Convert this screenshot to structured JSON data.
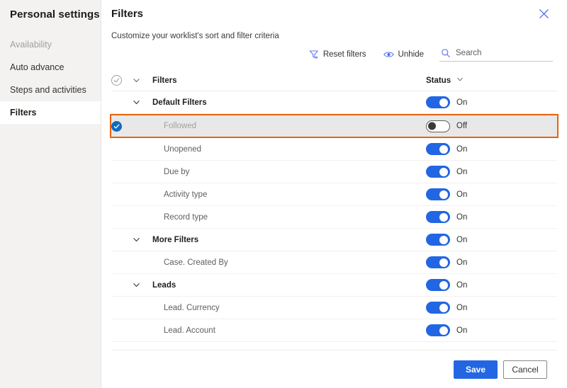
{
  "sidebar": {
    "title": "Personal settings",
    "items": [
      {
        "label": "Availability",
        "state": "disabled"
      },
      {
        "label": "Auto advance",
        "state": "normal"
      },
      {
        "label": "Steps and activities",
        "state": "normal"
      },
      {
        "label": "Filters",
        "state": "selected"
      }
    ]
  },
  "panel": {
    "title": "Filters",
    "subtitle": "Customize your worklist's sort and filter criteria",
    "close_label": "Close"
  },
  "toolbar": {
    "reset_filters_label": "Reset filters",
    "unhide_label": "Unhide",
    "search_placeholder": "Search",
    "search_value": ""
  },
  "table": {
    "header": {
      "name": "Filters",
      "status": "Status"
    },
    "rows": [
      {
        "label": "Default Filters",
        "type": "group",
        "indent": 0,
        "toggle": "on",
        "toggle_label": "On",
        "selected": false
      },
      {
        "label": "Followed",
        "type": "item",
        "indent": 1,
        "toggle": "off",
        "toggle_label": "Off",
        "selected": true
      },
      {
        "label": "Unopened",
        "type": "item",
        "indent": 1,
        "toggle": "on",
        "toggle_label": "On",
        "selected": false
      },
      {
        "label": "Due by",
        "type": "item",
        "indent": 1,
        "toggle": "on",
        "toggle_label": "On",
        "selected": false
      },
      {
        "label": "Activity type",
        "type": "item",
        "indent": 1,
        "toggle": "on",
        "toggle_label": "On",
        "selected": false
      },
      {
        "label": "Record type",
        "type": "item",
        "indent": 1,
        "toggle": "on",
        "toggle_label": "On",
        "selected": false
      },
      {
        "label": "More Filters",
        "type": "group",
        "indent": 0,
        "toggle": "on",
        "toggle_label": "On",
        "selected": false
      },
      {
        "label": "Case. Created By",
        "type": "item",
        "indent": 1,
        "toggle": "on",
        "toggle_label": "On",
        "selected": false
      },
      {
        "label": "Leads",
        "type": "group",
        "indent": 0,
        "toggle": "on",
        "toggle_label": "On",
        "selected": false
      },
      {
        "label": "Lead. Currency",
        "type": "item",
        "indent": 1,
        "toggle": "on",
        "toggle_label": "On",
        "selected": false
      },
      {
        "label": "Lead. Account",
        "type": "item",
        "indent": 1,
        "toggle": "on",
        "toggle_label": "On",
        "selected": false
      }
    ]
  },
  "footer": {
    "save_label": "Save",
    "cancel_label": "Cancel"
  },
  "colors": {
    "accent_blue": "#2266e3",
    "link_blue": "#4f6bed",
    "highlight_orange": "#e8630a",
    "sidebar_bg": "#f3f2f1",
    "selected_row_bg": "#e8e8e8"
  }
}
